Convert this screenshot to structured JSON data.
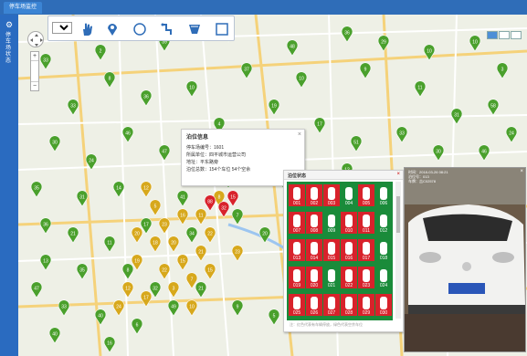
{
  "window": {
    "tab_title": "停车场监控"
  },
  "sidebar": {
    "label": "停车场状态"
  },
  "toolbar": {
    "level_value": "级别",
    "tools": [
      "hand-icon",
      "location-pin-icon",
      "circle-icon",
      "path-icon",
      "polygon-icon",
      "rectangle-icon"
    ]
  },
  "map": {
    "zoom_in": "+",
    "zoom_out": "−",
    "markers_green": [
      "33",
      "2",
      "39",
      "47",
      "48",
      "36",
      "29",
      "10",
      "10",
      "3",
      "8",
      "36",
      "33",
      "10",
      "37",
      "10",
      "9",
      "11",
      "31",
      "58",
      "30",
      "24",
      "46",
      "47",
      "4",
      "19",
      "17",
      "51",
      "33",
      "30",
      "35",
      "31",
      "14",
      "41",
      "9",
      "15",
      "12",
      "46",
      "24",
      "36",
      "21",
      "11",
      "17",
      "34",
      "7",
      "20",
      "13",
      "35",
      "8",
      "32",
      "47",
      "33",
      "40",
      "6",
      "49",
      "21",
      "9",
      "5",
      "40",
      "16"
    ],
    "markers_yellow": [
      "12",
      "5",
      "23",
      "20",
      "15",
      "7",
      "21",
      "22",
      "18",
      "19",
      "12",
      "24",
      "17",
      "22",
      "3",
      "11",
      "8",
      "23",
      "20",
      "16",
      "15",
      "10"
    ],
    "markers_red": [
      "88",
      "32",
      "15"
    ]
  },
  "info_popup": {
    "title": "泊位信息",
    "rows": [
      "停车场编号：1601",
      "所属单位：四平城市运营公司",
      "地址：平东路旁",
      "泊位总数：154个车位   54个空余"
    ]
  },
  "parking_grid": {
    "title": "泊位状态",
    "cells": [
      "001",
      "002",
      "003",
      "004",
      "005",
      "006",
      "007",
      "008",
      "009",
      "010",
      "011",
      "012",
      "013",
      "014",
      "015",
      "016",
      "017",
      "018",
      "019",
      "020",
      "021",
      "022",
      "023",
      "024",
      "025",
      "026",
      "027",
      "028",
      "029",
      "030"
    ],
    "occupied_color": "#d8222b",
    "free_color": "#1a8b3a",
    "occupied": [
      0,
      1,
      2,
      4,
      6,
      7,
      9,
      10,
      12,
      13,
      14,
      15,
      16,
      18,
      19,
      21,
      22,
      24,
      25,
      26,
      27,
      28,
      29
    ],
    "footer": "注：红色代表有车辆停放，绿色代表空余车位"
  },
  "photo": {
    "caption_lines": [
      "时间：2018-03-26 08:21",
      "泊位号：013",
      "车牌：吉C02578"
    ]
  }
}
